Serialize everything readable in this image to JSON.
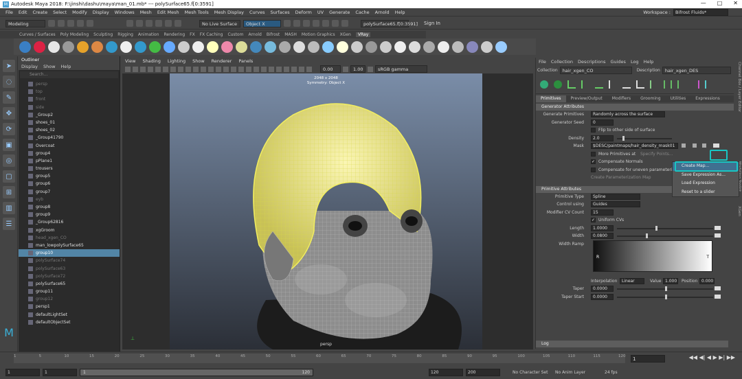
{
  "titlebar": {
    "text": "Autodesk Maya 2018: F:\\jinshi\\dashu\\maya\\man_01.mb*   ---   polySurface65.f[0:3591]",
    "min": "—",
    "max": "□",
    "close": "✕"
  },
  "menubar": {
    "items": [
      "File",
      "Edit",
      "Create",
      "Select",
      "Modify",
      "Display",
      "Windows",
      "Mesh",
      "Edit Mesh",
      "Mesh Tools",
      "Mesh Display",
      "Curves",
      "Surfaces",
      "Deform",
      "UV",
      "Generate",
      "Cache",
      "Arnold",
      "Help"
    ],
    "workspace_label": "Workspace :",
    "workspace_value": "Bifrost Fluids*"
  },
  "status": {
    "mode": "Modeling",
    "live": "No Live Surface",
    "object": "Object X",
    "selection": "polySurface65.f[0:3591]",
    "signin": "Sign In"
  },
  "shelf": {
    "tabs": [
      "Curves / Surfaces",
      "Poly Modeling",
      "Sculpting",
      "Rigging",
      "Animation",
      "Rendering",
      "FX",
      "FX Caching",
      "Custom",
      "Arnold",
      "Bifrost",
      "MASH",
      "Motion Graphics",
      "XGen",
      "VRay"
    ],
    "active": "VRay"
  },
  "outliner": {
    "title": "Outliner",
    "menu": [
      "Display",
      "Show",
      "Help"
    ],
    "search_placeholder": "Search...",
    "rows": [
      {
        "label": "persp",
        "dim": true
      },
      {
        "label": "top",
        "dim": true
      },
      {
        "label": "front",
        "dim": true
      },
      {
        "label": "side",
        "dim": true
      },
      {
        "label": "_Group2",
        "dim": false
      },
      {
        "label": "shoes_01",
        "dim": false
      },
      {
        "label": "shoes_02",
        "dim": false
      },
      {
        "label": "_Group41790",
        "dim": false
      },
      {
        "label": "Overcoat",
        "dim": false
      },
      {
        "label": "group4",
        "dim": false
      },
      {
        "label": "pPlane1",
        "dim": false
      },
      {
        "label": "trousers",
        "dim": false
      },
      {
        "label": "group5",
        "dim": false
      },
      {
        "label": "group6",
        "dim": false
      },
      {
        "label": "group7",
        "dim": false
      },
      {
        "label": "eyb",
        "dim": true
      },
      {
        "label": "group8",
        "dim": false
      },
      {
        "label": "group9",
        "dim": false
      },
      {
        "label": "_Group62816",
        "dim": false
      },
      {
        "label": "xgGroom",
        "dim": false
      },
      {
        "label": "head_xgen_CO",
        "dim": true
      },
      {
        "label": "man_lowpolySurface65",
        "dim": false
      },
      {
        "label": "group10",
        "dim": false,
        "sel": true
      },
      {
        "label": "polySurface74",
        "dim": true
      },
      {
        "label": "polySurface63",
        "dim": true
      },
      {
        "label": "polySurface72",
        "dim": true
      },
      {
        "label": "polySurface65",
        "dim": false
      },
      {
        "label": "group11",
        "dim": false
      },
      {
        "label": "group12",
        "dim": true
      },
      {
        "label": "persp1",
        "dim": false
      },
      {
        "label": "defaultLightSet",
        "dim": false
      },
      {
        "label": "defaultObjectSet",
        "dim": false
      }
    ]
  },
  "viewport": {
    "menu": [
      "View",
      "Shading",
      "Lighting",
      "Show",
      "Renderer",
      "Panels"
    ],
    "exposure": "0.00",
    "gamma": "1.00",
    "colorspace": "sRGB gamma",
    "resolution": "2048 x 2048",
    "symmetry": "Symmetry: Object X",
    "camera": "persp"
  },
  "xgen": {
    "menu": [
      "File",
      "Collection",
      "Descriptions",
      "Guides",
      "Log",
      "Help"
    ],
    "collection_label": "Collection",
    "collection": "hair_xgen_CO",
    "description_label": "Description",
    "description": "hair_xgen_DES",
    "tabs": [
      "Primitives",
      "Preview/Output",
      "Modifiers",
      "Grooming",
      "Utilities",
      "Expressions"
    ],
    "active_tab": "Primitives",
    "gen_section": "Generator Attributes",
    "generate_label": "Generate Primitives",
    "generate_value": "Randomly across the surface",
    "seed_label": "Generator Seed",
    "seed_value": "0",
    "flip_label": "Flip to other side of surface",
    "density_label": "Density",
    "density_value": "2.0",
    "density_level": 0.1,
    "mask_label": "Mask",
    "mask_value": "$DESC/paintmaps/hair_density_mask01",
    "more_label": "More Primitives at",
    "specify_label": "Specify Points...",
    "comp_label": "Compensate Normals",
    "comp2_label": "Compensate for uneven parameterization",
    "create_param_label": "Create Parameterization Map",
    "prim_section": "Primitive Attributes",
    "ptype_label": "Primitive Type",
    "ptype_value": "Spline",
    "control_label": "Control using",
    "control_value": "Guides",
    "cv_label": "Modifier CV Count",
    "cv_value": "15",
    "uniform_label": "Uniform CVs",
    "length_label": "Length",
    "length_value": "1.0000",
    "length_level": 0.4,
    "width_label": "Width",
    "width_value": "0.0800",
    "width_level": 0.3,
    "ramp_label": "Width Ramp",
    "ramp_r": "R",
    "ramp_t": "T",
    "interp_label": "Interpolation",
    "interp_value": "Linear",
    "value_label": "Value",
    "value_value": "1.000",
    "pos_label": "Position",
    "pos_value": "0.000",
    "taper_label": "Taper",
    "taper_value": "0.0000",
    "taper_level": 0.5,
    "taperstart_label": "Taper Start",
    "taperstart_value": "0.0000",
    "taperstart_level": 0.5,
    "log_section": "Log"
  },
  "popup": {
    "items": [
      "Create Map...",
      "Save Expression As...",
      "Load Expression",
      "Reset to a slider"
    ]
  },
  "side_tabs": {
    "right1": "Channel Box / Layer Editor",
    "right2": "Modeling Toolkit",
    "right3": "XGen"
  },
  "timeline": {
    "ticks": [
      "1",
      "5",
      "10",
      "15",
      "20",
      "25",
      "30",
      "35",
      "40",
      "45",
      "50",
      "55",
      "60",
      "65",
      "70",
      "75",
      "80",
      "85",
      "90",
      "95",
      "100",
      "105",
      "110",
      "115",
      "120"
    ],
    "frame": "1",
    "play": "◀◀ ◀| ◀ ▶ ▶| ▶▶"
  },
  "range": {
    "start": "1",
    "start2": "1",
    "cur": "1",
    "end1": "120",
    "end2": "120",
    "end3": "200",
    "charset": "No Character Set",
    "animlayer": "No Anim Layer",
    "fps": "24 fps"
  },
  "colors": {
    "accent": "#18c6c3",
    "selection": "#5285a6",
    "wire": "#e8e44a"
  }
}
